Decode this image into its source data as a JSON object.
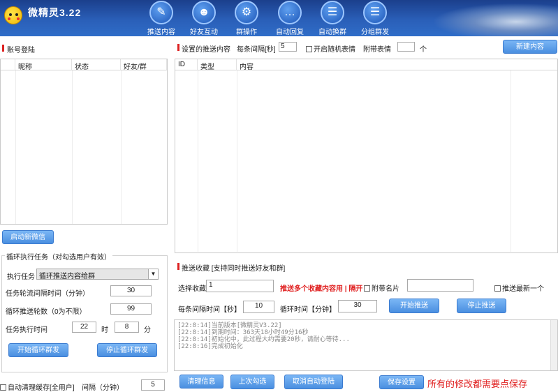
{
  "app": {
    "title": "微精灵3.22"
  },
  "nav": [
    {
      "label": "推送内容",
      "icon": "paper-plane-icon"
    },
    {
      "label": "好友互动",
      "icon": "users-icon"
    },
    {
      "label": "群操作",
      "icon": "gear-icon"
    },
    {
      "label": "自动回复",
      "icon": "chat-icon"
    },
    {
      "label": "自动换群",
      "icon": "chat-switch-icon"
    },
    {
      "label": "分组群发",
      "icon": "group-chat-icon"
    }
  ],
  "left": {
    "title": "账号登陆",
    "columns": [
      "昵称",
      "状态",
      "好友/群"
    ],
    "auto_new_wechat": "启动新微信",
    "loop_task": {
      "title": "循环执行任务（对勾选用户有效）",
      "task_label": "执行任务",
      "task_value": "循环推送内容给群",
      "interval_label": "任务轮流间隔时间（分钟）",
      "interval_value": "30",
      "rounds_label": "循环推送轮数（0为不限）",
      "rounds_value": "99",
      "time_label": "任务执行时间",
      "hour_value": "22",
      "hour_unit": "时",
      "minute_value": "8",
      "minute_unit": "分",
      "start_btn": "开始循环群发",
      "stop_btn": "停止循环群发"
    },
    "auto_clear_label": "自动清理缓存[全用户]",
    "clear_interval_label": "间隔（分钟）",
    "clear_interval_value": "5"
  },
  "right": {
    "title": "设置的推送内容",
    "interval_label": "每条间隔[秒]",
    "interval_value": "5",
    "random_emoji_label": "开启随机表情",
    "attach_emoji_label": "附带表情",
    "attach_emoji_value": "",
    "attach_unit": "个",
    "new_btn": "新建内容",
    "columns": [
      "ID",
      "类型",
      "内容"
    ],
    "fav": {
      "title": "推送收藏 [支持同时推送好友和群]",
      "select_label": "选择收藏",
      "select_value": "1",
      "hint_red": "推送多个收藏内容用 | 隔开",
      "card_label": "附带名片",
      "card_value": "",
      "latest_label": "推送最新一个",
      "interval_label": "每条间隔时间【秒】",
      "interval_value": "10",
      "loop_label": "循环时间【分钟】",
      "loop_value": "30",
      "start_btn": "开始推送",
      "stop_btn": "停止推送"
    },
    "log": [
      "[22:8:14]当前版本[微精灵V3.22]",
      "[22:8:14]到期时间：363天18小时49分16秒",
      "[22:8:14]初始化中，此过程大约需要20秒，请耐心等待...",
      "[22:8:16]完成初始化"
    ]
  },
  "bottom": {
    "clear_btn": "清理信息",
    "last_check_btn": "上次勾选",
    "cancel_auto_btn": "取消自动登陆",
    "save_btn": "保存设置",
    "save_notice": "所有的修改都需要点保存"
  },
  "colors": {
    "header": "#2a5fb8",
    "button": "#4a8fe0",
    "notice": "#e02020"
  }
}
